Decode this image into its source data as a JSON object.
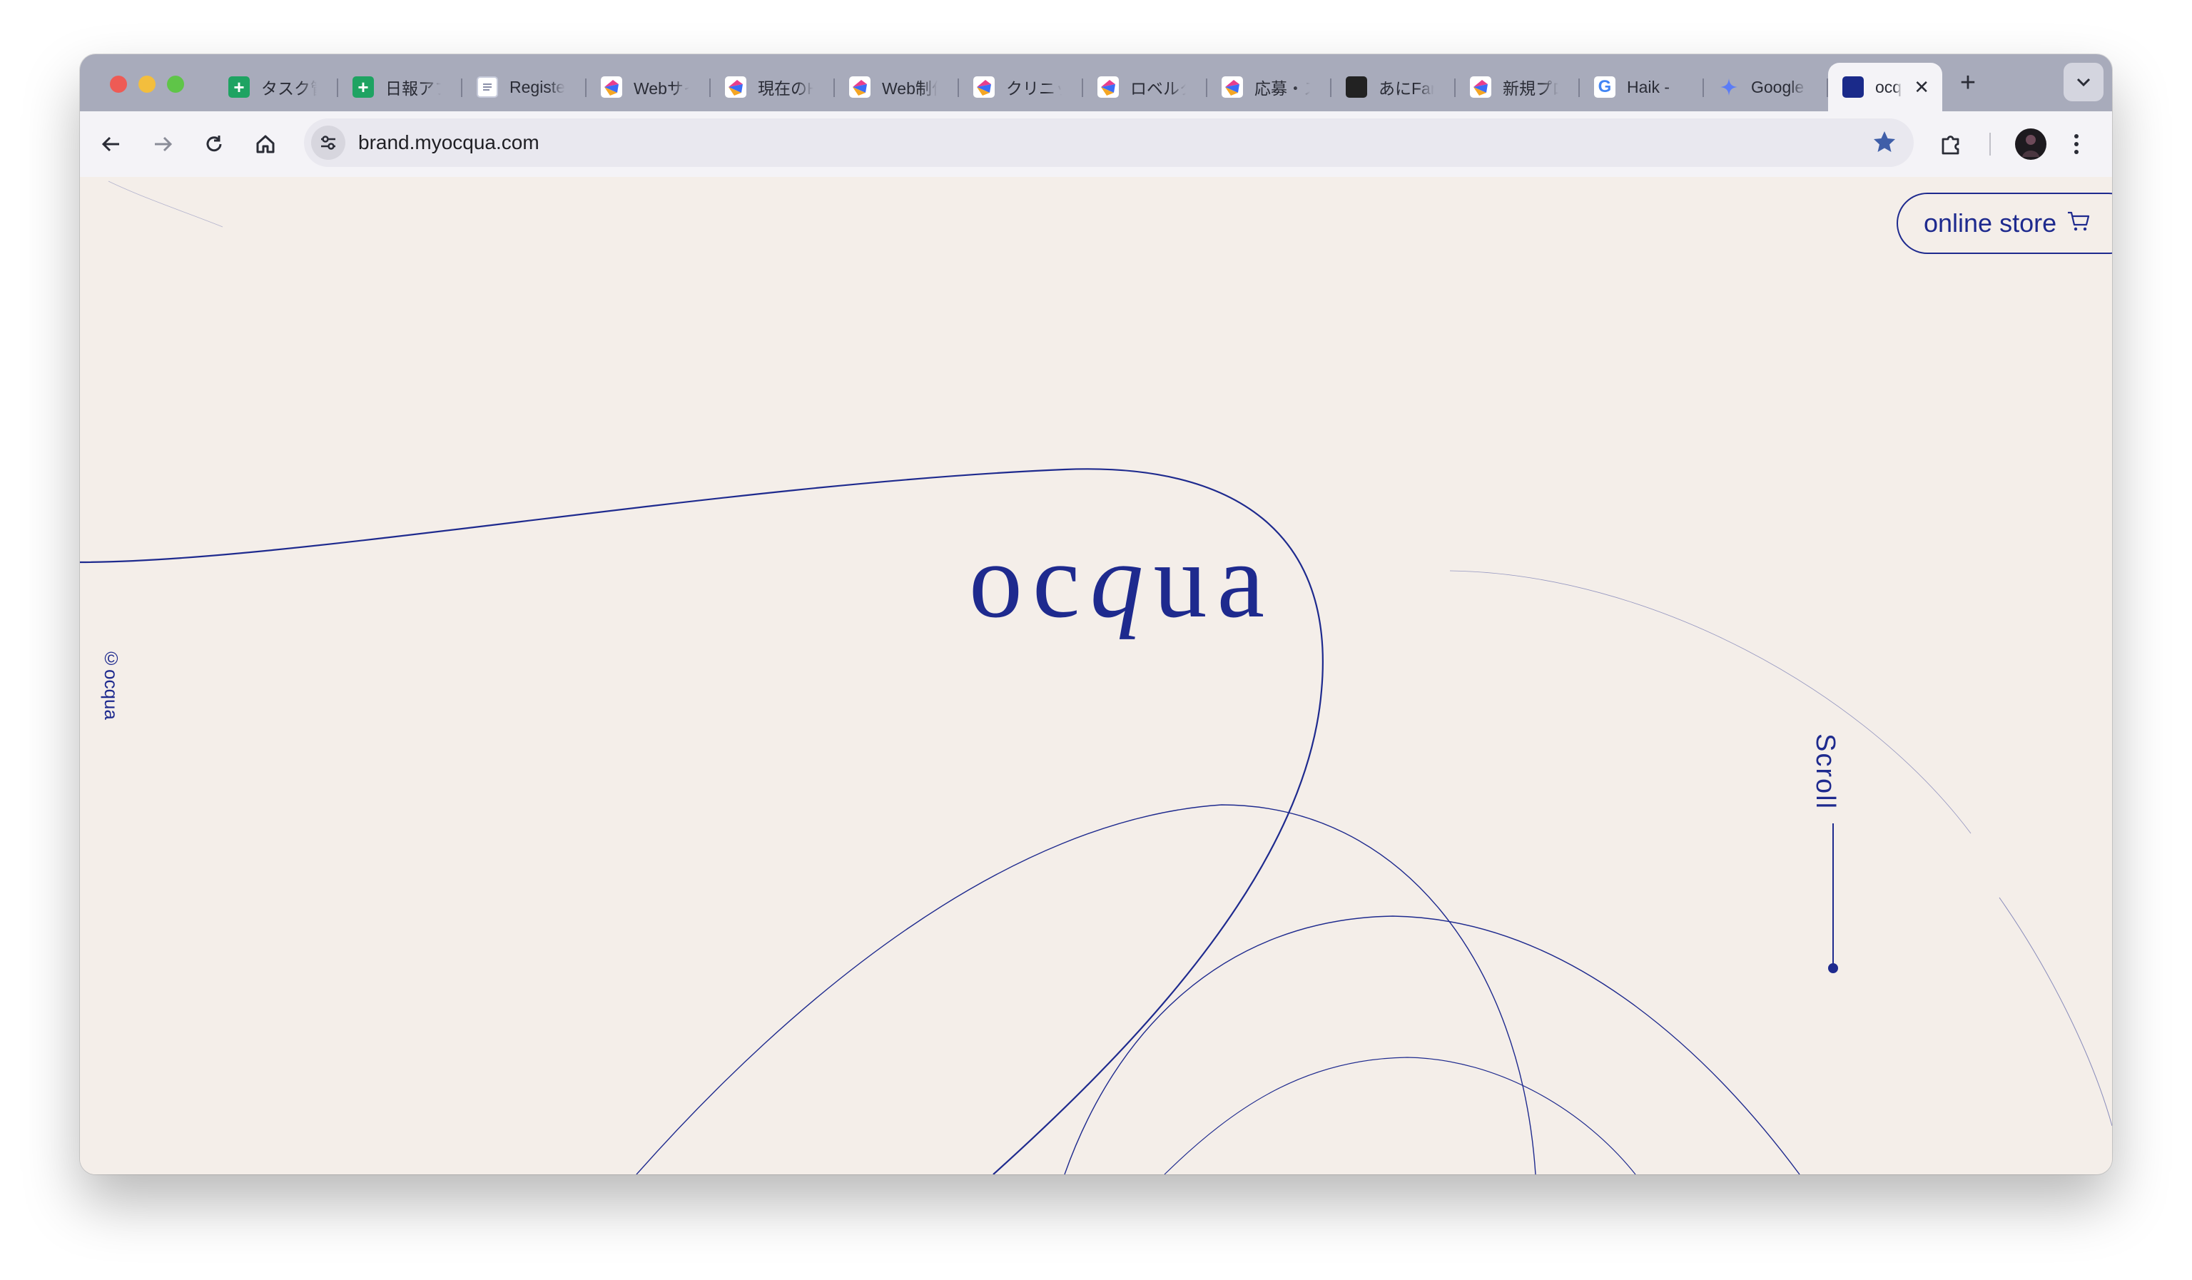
{
  "browser": {
    "tabs": [
      {
        "label": "タスク管",
        "favicon": "sheets-icon"
      },
      {
        "label": "日報アプ",
        "favicon": "sheets-icon"
      },
      {
        "label": "Register",
        "favicon": "doc-icon"
      },
      {
        "label": "Webサイ",
        "favicon": "studio-icon"
      },
      {
        "label": "現在のH",
        "favicon": "studio-icon"
      },
      {
        "label": "Web制作",
        "favicon": "studio-icon"
      },
      {
        "label": "クリニック",
        "favicon": "studio-icon"
      },
      {
        "label": "ロベルタ",
        "favicon": "studio-icon"
      },
      {
        "label": "応募・ス",
        "favicon": "studio-icon"
      },
      {
        "label": "あにFar",
        "favicon": "dark-icon"
      },
      {
        "label": "新規プロ",
        "favicon": "studio-icon"
      },
      {
        "label": "Haik - ",
        "favicon": "google-icon"
      },
      {
        "label": "Google",
        "favicon": "gemini-icon"
      },
      {
        "label": "ocqua",
        "favicon": "ocqua-icon",
        "active": true
      }
    ],
    "url": "brand.myocqua.com"
  },
  "page": {
    "logo_pre": "oc",
    "logo_q": "q",
    "logo_post": "ua",
    "copyright": "©ocqua",
    "scroll_label": "Scroll",
    "store_label": "online store"
  },
  "colors": {
    "brand": "#1e2a8e",
    "background": "#f4eee9"
  }
}
